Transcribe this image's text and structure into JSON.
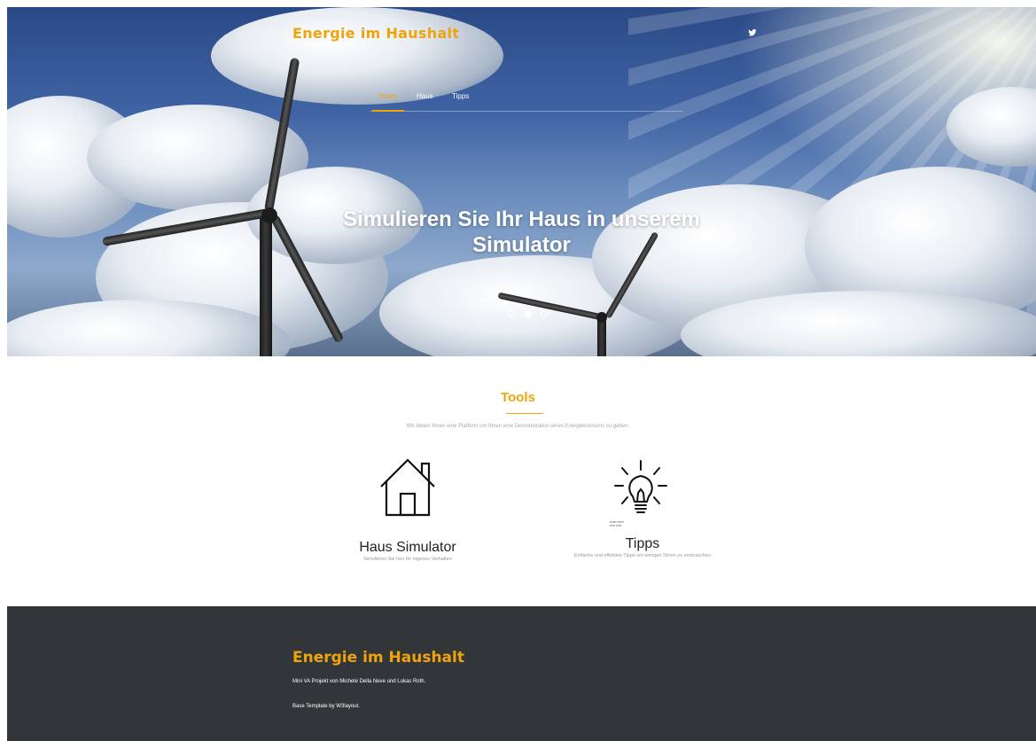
{
  "brand": "Energie im Haushalt",
  "colors": {
    "accent": "#f0a30a",
    "footer_bg": "#333639"
  },
  "header": {
    "social_icon": "twitter-icon",
    "nav": [
      {
        "label": "Home",
        "active": true
      },
      {
        "label": "Haus",
        "active": false
      },
      {
        "label": "Tipps",
        "active": false
      }
    ]
  },
  "hero": {
    "title_line1": "Simulieren Sie Ihr Haus in unserem",
    "title_line2": "Simulator",
    "carousel_active_index": 1,
    "carousel_count": 3
  },
  "tools": {
    "title": "Tools",
    "subtitle": "Wir bieten Ihnen eine Platform um Ihnen eine Demonstration eines Energiekonsums zu geben.",
    "cards": [
      {
        "icon": "house-icon",
        "title": "Haus Simulator",
        "description": "Simulieren Sie hier Ihr eigenes Verhalten"
      },
      {
        "icon": "light-bulb-icon",
        "title": "Tipps",
        "description": "Einfache und effektive Tipps um weniger Strom zu verbrauchen"
      }
    ]
  },
  "footer": {
    "brand": "Energie im Haushalt",
    "line1": "Mini VA Projekt von Michele Della Neve und Lukas Roth.",
    "line2": "Base Template by W3layout."
  }
}
